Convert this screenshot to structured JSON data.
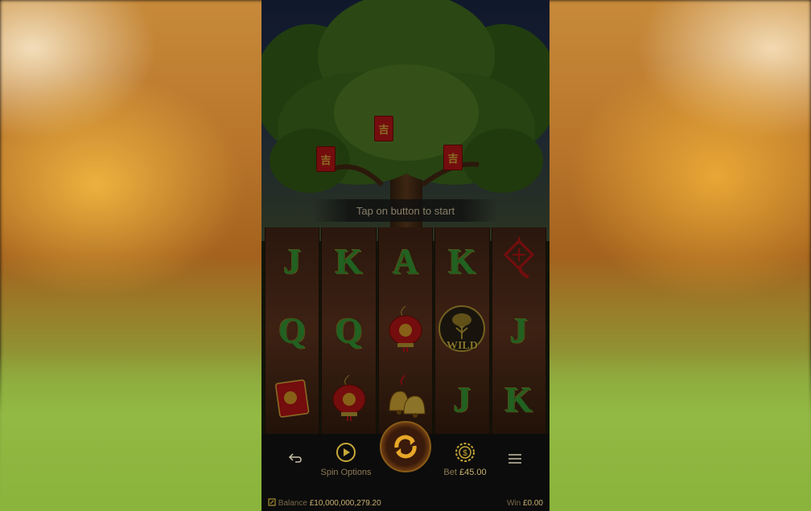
{
  "banner": {
    "text": "Tap on button to start"
  },
  "reels": [
    [
      {
        "type": "letter",
        "label": "J"
      },
      {
        "type": "letter",
        "label": "Q"
      },
      {
        "type": "icon",
        "icon": "red-envelope-icon"
      }
    ],
    [
      {
        "type": "letter",
        "label": "K"
      },
      {
        "type": "letter",
        "label": "Q"
      },
      {
        "type": "icon",
        "icon": "red-lantern-icon"
      }
    ],
    [
      {
        "type": "letter",
        "label": "A"
      },
      {
        "type": "icon",
        "icon": "red-lantern-icon"
      },
      {
        "type": "icon",
        "icon": "golden-bells-icon"
      }
    ],
    [
      {
        "type": "letter",
        "label": "K"
      },
      {
        "type": "icon",
        "icon": "wild-tree-icon",
        "label": "WILD"
      },
      {
        "type": "letter",
        "label": "J"
      }
    ],
    [
      {
        "type": "icon",
        "icon": "chinese-knot-icon"
      },
      {
        "type": "letter",
        "label": "J"
      },
      {
        "type": "letter",
        "label": "K"
      }
    ]
  ],
  "controls": {
    "spin_options_label": "Spin Options",
    "bet_label": "Bet",
    "bet_value": "£45.00"
  },
  "status": {
    "balance_label": "Balance",
    "balance_value": "£10,000,000,279.20",
    "win_label": "Win",
    "win_value": "£0.00"
  },
  "envelope_glyph": "吉",
  "colors": {
    "accent_gold": "#c8a838",
    "letter_green": "#3aa83a",
    "envelope_red": "#c81818"
  }
}
